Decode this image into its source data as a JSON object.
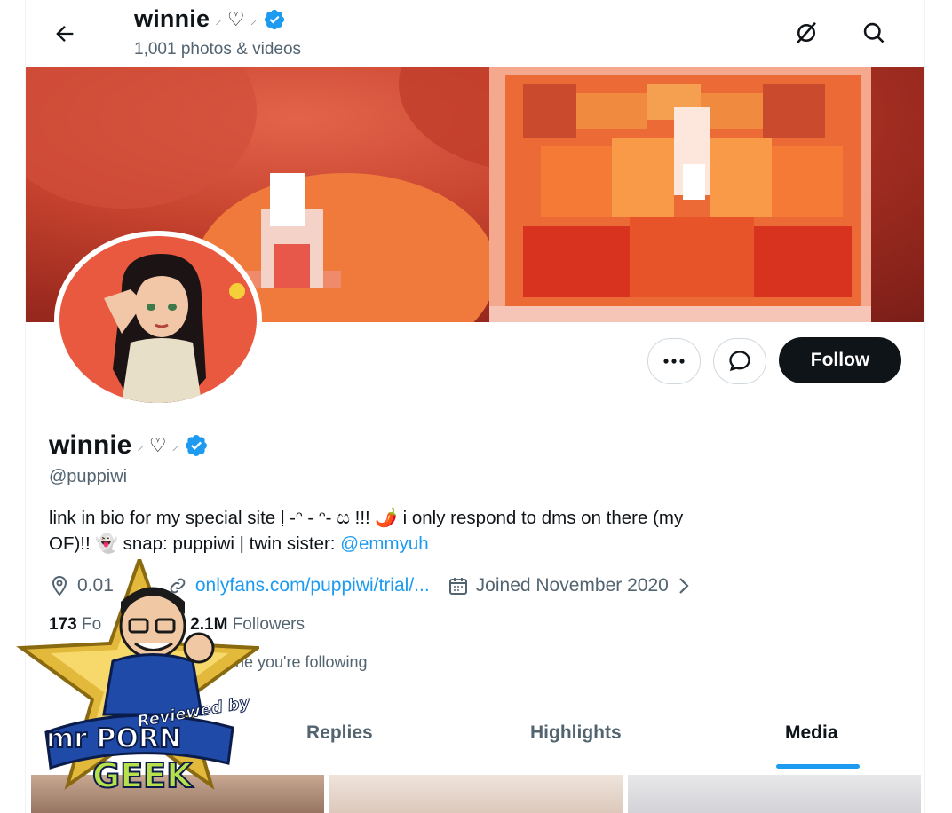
{
  "header": {
    "title": "winnie",
    "subtitle": "1,001 photos & videos"
  },
  "actions": {
    "follow_label": "Follow"
  },
  "profile": {
    "name": "winnie",
    "decor_left": "⸝",
    "decor_heart": "♡",
    "decor_right": "⸝",
    "handle": "@puppiwi",
    "bio_line1": "link in bio for my special site ḷ -ᵔ - ᵔ- ස !!! 🌶️ i only respond to dms on there (my",
    "bio_line2_prefix": "OF)!! 👻 snap: puppiwi | twin sister: ",
    "bio_mention": "@emmyuh",
    "location": "0.01",
    "website": "onlyfans.com/puppiwi/trial/...",
    "joined": "Joined November 2020",
    "following_count": "173",
    "following_label": "Fo",
    "followers_count": "2.1M",
    "followers_label": "Followers",
    "followed_by": "one you're following"
  },
  "tabs": [
    {
      "label": "Replies"
    },
    {
      "label": "Highlights"
    },
    {
      "label": "Media",
      "active": true
    }
  ],
  "watermark": {
    "line1": "Reviewed by",
    "line2": "mr PORN",
    "line3": "GEEK"
  },
  "colors": {
    "accent": "#1d9bf0",
    "text": "#0f1419",
    "muted": "#536471",
    "follow_bg": "#0f1419"
  },
  "icons": [
    "back-arrow-icon",
    "hidden-icon",
    "search-icon",
    "more-icon",
    "message-icon",
    "verified-icon",
    "location-icon",
    "link-icon",
    "calendar-icon",
    "chevron-right-icon"
  ]
}
